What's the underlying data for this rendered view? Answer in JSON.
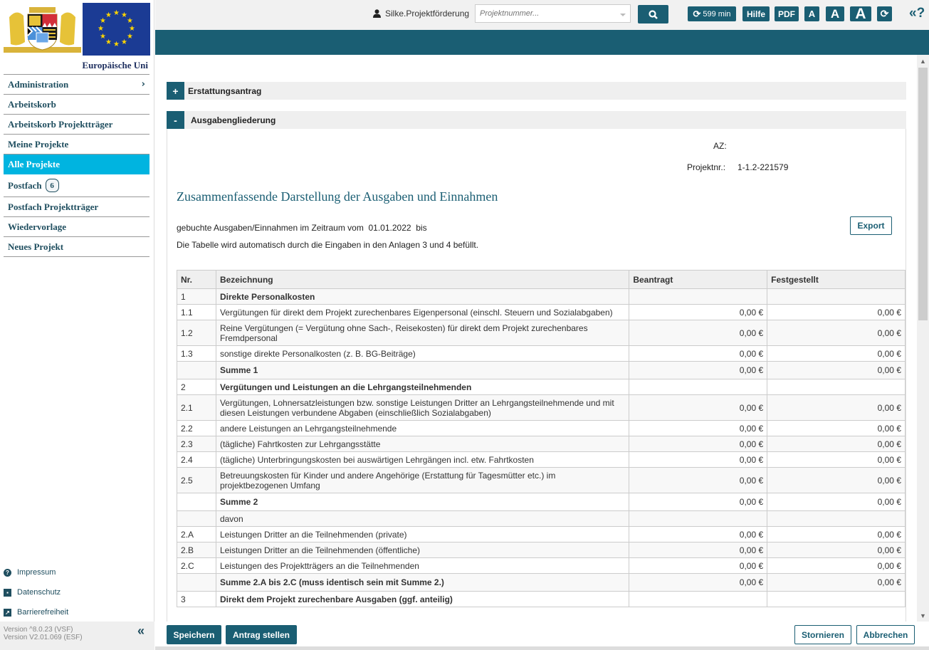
{
  "sidebar": {
    "brand_text": "Europäische Uni",
    "nav": [
      {
        "label": "Administration",
        "has_submenu": true
      },
      {
        "label": "Arbeitskorb"
      },
      {
        "label": "Arbeitskorb Projektträger"
      },
      {
        "label": "Meine Projekte"
      },
      {
        "label": "Alle Projekte",
        "active": true
      },
      {
        "label": "Postfach",
        "badge": "6"
      },
      {
        "label": "Postfach Projektträger"
      },
      {
        "label": "Wiedervorlage"
      },
      {
        "label": "Neues Projekt"
      }
    ],
    "footer_links": [
      {
        "label": "Impressum",
        "icon": "question-circle-icon"
      },
      {
        "label": "Datenschutz",
        "icon": "id-badge-icon"
      },
      {
        "label": "Barrierefreiheit",
        "icon": "external-link-icon"
      }
    ],
    "version_lines": [
      "Version ^8.0.23 (VSF)",
      "Version V2.01.069 (ESF)"
    ],
    "collapse_glyph": "«"
  },
  "topbar": {
    "user": "Silke.Projektförderung",
    "search_placeholder": "Projektnummer...",
    "session_timer": "599 min",
    "help_label": "Hilfe",
    "pdf_label": "PDF",
    "font_small": "A",
    "font_medium": "A",
    "font_large": "A",
    "help_glyph": "«?"
  },
  "sections": {
    "erstattungsantrag": {
      "toggle": "+",
      "label": "Erstattungsantrag"
    },
    "ausgabengliederung": {
      "toggle": "-",
      "label": "Ausgabengliederung"
    }
  },
  "meta": {
    "az_label": "AZ:",
    "az_value": "",
    "projektnr_label": "Projektnr.:",
    "projektnr_value": "1-1.2-221579"
  },
  "main": {
    "title": "Zusammenfassende Darstellung der Ausgaben und Einnahmen",
    "period_text": "gebuchte Ausgaben/Einnahmen im Zeitraum vom",
    "period_from": "01.01.2022",
    "period_to_label": "bis",
    "note": "Die Tabelle wird automatisch durch die Eingaben in den Anlagen 3 und 4 befüllt.",
    "export_label": "Export"
  },
  "table": {
    "headers": [
      "Nr.",
      "Bezeichnung",
      "Beantragt",
      "Festgestellt"
    ],
    "rows": [
      {
        "nr": "1",
        "desc": "Direkte Personalkosten",
        "beantragt": "",
        "festgestellt": "",
        "bold": true
      },
      {
        "nr": "1.1",
        "desc": "Vergütungen für direkt dem Projekt zurechenbares Eigenpersonal (einschl. Steuern und Sozialabgaben)",
        "beantragt": "0,00 €",
        "festgestellt": "0,00 €"
      },
      {
        "nr": "1.2",
        "desc": "Reine Vergütungen (= Vergütung ohne Sach-, Reisekosten) für direkt dem Projekt zurechenbares Fremdpersonal",
        "beantragt": "0,00 €",
        "festgestellt": "0,00 €"
      },
      {
        "nr": "1.3",
        "desc": "sonstige direkte Personalkosten (z. B. BG-Beiträge)",
        "beantragt": "0,00 €",
        "festgestellt": "0,00 €"
      },
      {
        "nr": "",
        "desc": "Summe 1",
        "beantragt": "0,00 €",
        "festgestellt": "0,00 €",
        "bold": true
      },
      {
        "nr": "2",
        "desc": "Vergütungen und Leistungen an die Lehrgangsteilnehmenden",
        "beantragt": "",
        "festgestellt": "",
        "bold": true
      },
      {
        "nr": "2.1",
        "desc": "Vergütungen, Lohnersatzleistungen bzw. sonstige Leistungen Dritter an Lehrgangsteilnehmende und mit diesen Leistungen verbundene Abgaben (einschließlich Sozialabgaben)",
        "beantragt": "0,00 €",
        "festgestellt": "0,00 €"
      },
      {
        "nr": "2.2",
        "desc": "andere Leistungen an Lehrgangsteilnehmende",
        "beantragt": "0,00 €",
        "festgestellt": "0,00 €"
      },
      {
        "nr": "2.3",
        "desc": "(tägliche) Fahrtkosten zur Lehrgangsstätte",
        "beantragt": "0,00 €",
        "festgestellt": "0,00 €"
      },
      {
        "nr": "2.4",
        "desc": "(tägliche) Unterbringungskosten bei auswärtigen Lehrgängen incl. etw. Fahrtkosten",
        "beantragt": "0,00 €",
        "festgestellt": "0,00 €"
      },
      {
        "nr": "2.5",
        "desc": "Betreuungskosten für Kinder und andere Angehörige (Erstattung für Tagesmütter etc.) im projektbezogenen Umfang",
        "beantragt": "0,00 €",
        "festgestellt": "0,00 €"
      },
      {
        "nr": "",
        "desc": "Summe 2",
        "beantragt": "0,00 €",
        "festgestellt": "0,00 €",
        "bold": true
      },
      {
        "nr": "",
        "desc": "davon",
        "beantragt": "",
        "festgestellt": ""
      },
      {
        "nr": "2.A",
        "desc": "Leistungen Dritter an die Teilnehmenden (private)",
        "beantragt": "0,00 €",
        "festgestellt": "0,00 €"
      },
      {
        "nr": "2.B",
        "desc": "Leistungen Dritter an die Teilnehmenden (öffentliche)",
        "beantragt": "0,00 €",
        "festgestellt": "0,00 €"
      },
      {
        "nr": "2.C",
        "desc": "Leistungen des Projektträgers an die Teilnehmenden",
        "beantragt": "0,00 €",
        "festgestellt": "0,00 €"
      },
      {
        "nr": "",
        "desc": "Summe 2.A bis 2.C (muss identisch sein mit Summe 2.)",
        "beantragt": "0,00 €",
        "festgestellt": "0,00 €",
        "bold": true
      },
      {
        "nr": "3",
        "desc": "Direkt dem Projekt zurechenbare Ausgaben (ggf. anteilig)",
        "beantragt": "",
        "festgestellt": "",
        "bold": true
      }
    ]
  },
  "actions": {
    "save": "Speichern",
    "submit": "Antrag stellen",
    "cancel_request": "Stornieren",
    "abort": "Abbrechen"
  }
}
